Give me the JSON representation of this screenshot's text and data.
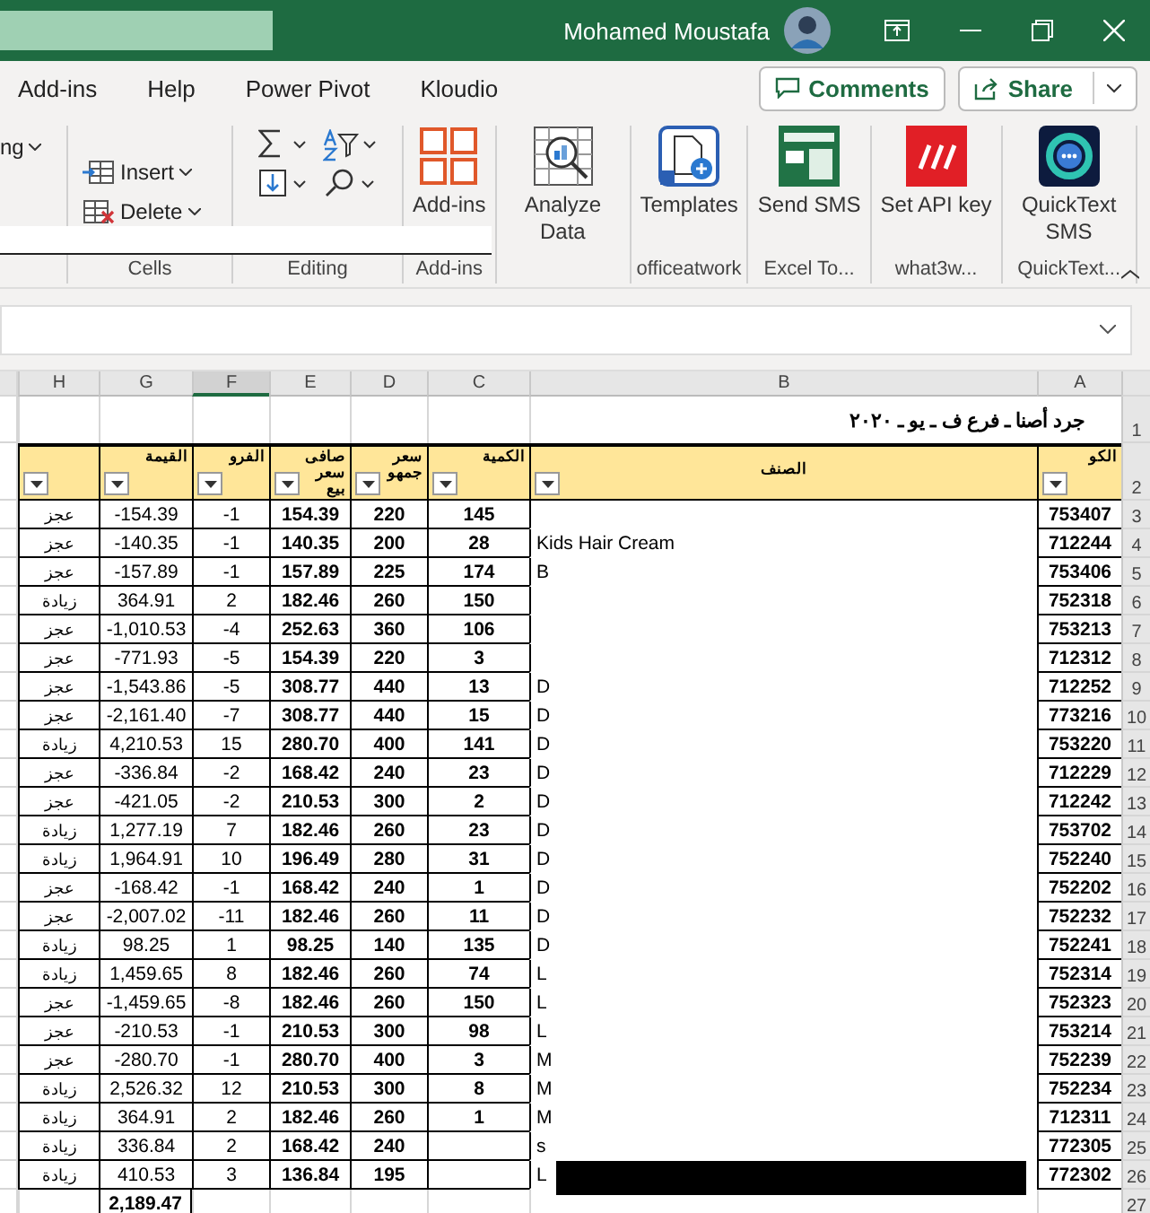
{
  "title_bar": {
    "user": "Mohamed Moustafa"
  },
  "menu_tabs": [
    {
      "label": "Add-ins",
      "selected": false
    },
    {
      "label": "Help",
      "selected": false
    },
    {
      "label": "Power Pivot",
      "selected": false
    },
    {
      "label": "Kloudio",
      "selected": false
    }
  ],
  "header_buttons": {
    "comments": "Comments",
    "share": "Share"
  },
  "ribbon": {
    "partial_dropdown": "ng",
    "cells_group": {
      "label": "Cells",
      "buttons": [
        "Insert",
        "Delete"
      ]
    },
    "editing_group": {
      "label": "Editing"
    },
    "large_groups": [
      {
        "label": "Add-ins",
        "buttons": [
          {
            "label": "Add-ins",
            "kind": "grid"
          }
        ]
      },
      {
        "buttons": [
          {
            "label": "Analyze Data",
            "kind": "analyze"
          }
        ]
      },
      {
        "label": "officeatwork",
        "buttons": [
          {
            "label": "Templates",
            "kind": "templates"
          }
        ]
      },
      {
        "label": "Excel To...",
        "buttons": [
          {
            "label": "Send SMS",
            "kind": "sms"
          }
        ]
      },
      {
        "label": "what3w...",
        "buttons": [
          {
            "label": "Set API key",
            "kind": "slashes"
          }
        ]
      },
      {
        "label": "QuickText...",
        "buttons": [
          {
            "label": "QuickText SMS",
            "kind": "chat"
          }
        ]
      }
    ]
  },
  "sheet": {
    "column_letters": [
      "H",
      "G",
      "F",
      "E",
      "D",
      "C",
      "B",
      "A"
    ],
    "title_row_number": "1",
    "title": "جرد أصنا ـ فرع   ف ـ يو ـ ٢٠٢٠",
    "header_row_number": "2",
    "headers": [
      "الكو",
      "الصنف",
      "الكمية",
      "سعر جمهو",
      "صافى سعر بيع",
      "الفرو",
      "القيمة"
    ],
    "rows": [
      {
        "number": "3",
        "code": "753407",
        "item": "",
        "qty": "145",
        "public_price": "220",
        "net_price": "154.39",
        "diff": "-1",
        "value": "-154.39",
        "status": "عجز"
      },
      {
        "number": "4",
        "code": "712244",
        "item": "Kids Hair Cream",
        "qty": "28",
        "public_price": "200",
        "net_price": "140.35",
        "diff": "-1",
        "value": "-140.35",
        "status": "عجز"
      },
      {
        "number": "5",
        "code": "753406",
        "item": "B",
        "qty": "174",
        "public_price": "225",
        "net_price": "157.89",
        "diff": "-1",
        "value": "-157.89",
        "status": "عجز"
      },
      {
        "number": "6",
        "code": "752318",
        "item": "",
        "qty": "150",
        "public_price": "260",
        "net_price": "182.46",
        "diff": "2",
        "value": "364.91",
        "status": "زيادة"
      },
      {
        "number": "7",
        "code": "753213",
        "item": "",
        "qty": "106",
        "public_price": "360",
        "net_price": "252.63",
        "diff": "-4",
        "value": "-1,010.53",
        "status": "عجز"
      },
      {
        "number": "8",
        "code": "712312",
        "item": "",
        "qty": "3",
        "public_price": "220",
        "net_price": "154.39",
        "diff": "-5",
        "value": "-771.93",
        "status": "عجز"
      },
      {
        "number": "9",
        "code": "712252",
        "item": "D",
        "qty": "13",
        "public_price": "440",
        "net_price": "308.77",
        "diff": "-5",
        "value": "-1,543.86",
        "status": "عجز"
      },
      {
        "number": "10",
        "code": "773216",
        "item": "D",
        "qty": "15",
        "public_price": "440",
        "net_price": "308.77",
        "diff": "-7",
        "value": "-2,161.40",
        "status": "عجز"
      },
      {
        "number": "11",
        "code": "753220",
        "item": "D",
        "qty": "141",
        "public_price": "400",
        "net_price": "280.70",
        "diff": "15",
        "value": "4,210.53",
        "status": "زيادة"
      },
      {
        "number": "12",
        "code": "712229",
        "item": "D",
        "qty": "23",
        "public_price": "240",
        "net_price": "168.42",
        "diff": "-2",
        "value": "-336.84",
        "status": "عجز"
      },
      {
        "number": "13",
        "code": "712242",
        "item": "D",
        "qty": "2",
        "public_price": "300",
        "net_price": "210.53",
        "diff": "-2",
        "value": "-421.05",
        "status": "عجز"
      },
      {
        "number": "14",
        "code": "753702",
        "item": "D",
        "qty": "23",
        "public_price": "260",
        "net_price": "182.46",
        "diff": "7",
        "value": "1,277.19",
        "status": "زيادة"
      },
      {
        "number": "15",
        "code": "752240",
        "item": "D",
        "qty": "31",
        "public_price": "280",
        "net_price": "196.49",
        "diff": "10",
        "value": "1,964.91",
        "status": "زيادة"
      },
      {
        "number": "16",
        "code": "752202",
        "item": "D",
        "qty": "1",
        "public_price": "240",
        "net_price": "168.42",
        "diff": "-1",
        "value": "-168.42",
        "status": "عجز"
      },
      {
        "number": "17",
        "code": "752232",
        "item": "D",
        "qty": "11",
        "public_price": "260",
        "net_price": "182.46",
        "diff": "-11",
        "value": "-2,007.02",
        "status": "عجز"
      },
      {
        "number": "18",
        "code": "752241",
        "item": "D",
        "qty": "135",
        "public_price": "140",
        "net_price": "98.25",
        "diff": "1",
        "value": "98.25",
        "status": "زيادة"
      },
      {
        "number": "19",
        "code": "752314",
        "item": "L",
        "qty": "74",
        "public_price": "260",
        "net_price": "182.46",
        "diff": "8",
        "value": "1,459.65",
        "status": "زيادة"
      },
      {
        "number": "20",
        "code": "752323",
        "item": "L",
        "qty": "150",
        "public_price": "260",
        "net_price": "182.46",
        "diff": "-8",
        "value": "-1,459.65",
        "status": "عجز"
      },
      {
        "number": "21",
        "code": "753214",
        "item": "L",
        "qty": "98",
        "public_price": "300",
        "net_price": "210.53",
        "diff": "-1",
        "value": "-210.53",
        "status": "عجز"
      },
      {
        "number": "22",
        "code": "752239",
        "item": "M",
        "qty": "3",
        "public_price": "400",
        "net_price": "280.70",
        "diff": "-1",
        "value": "-280.70",
        "status": "عجز"
      },
      {
        "number": "23",
        "code": "752234",
        "item": "M",
        "qty": "8",
        "public_price": "300",
        "net_price": "210.53",
        "diff": "12",
        "value": "2,526.32",
        "status": "زيادة"
      },
      {
        "number": "24",
        "code": "712311",
        "item": "M",
        "qty": "1",
        "public_price": "260",
        "net_price": "182.46",
        "diff": "2",
        "value": "364.91",
        "status": "زيادة"
      },
      {
        "number": "25",
        "code": "772305",
        "item": "s",
        "public_price": "240",
        "net_price": "168.42",
        "diff": "2",
        "value": "336.84",
        "status": "زيادة"
      },
      {
        "number": "26",
        "code": "772302",
        "item": "L",
        "public_price": "195",
        "net_price": "136.84",
        "diff": "3",
        "value": "410.53",
        "status": "زيادة",
        "redacted": true
      }
    ],
    "total": {
      "number": "27",
      "value": "2,189.47"
    }
  }
}
